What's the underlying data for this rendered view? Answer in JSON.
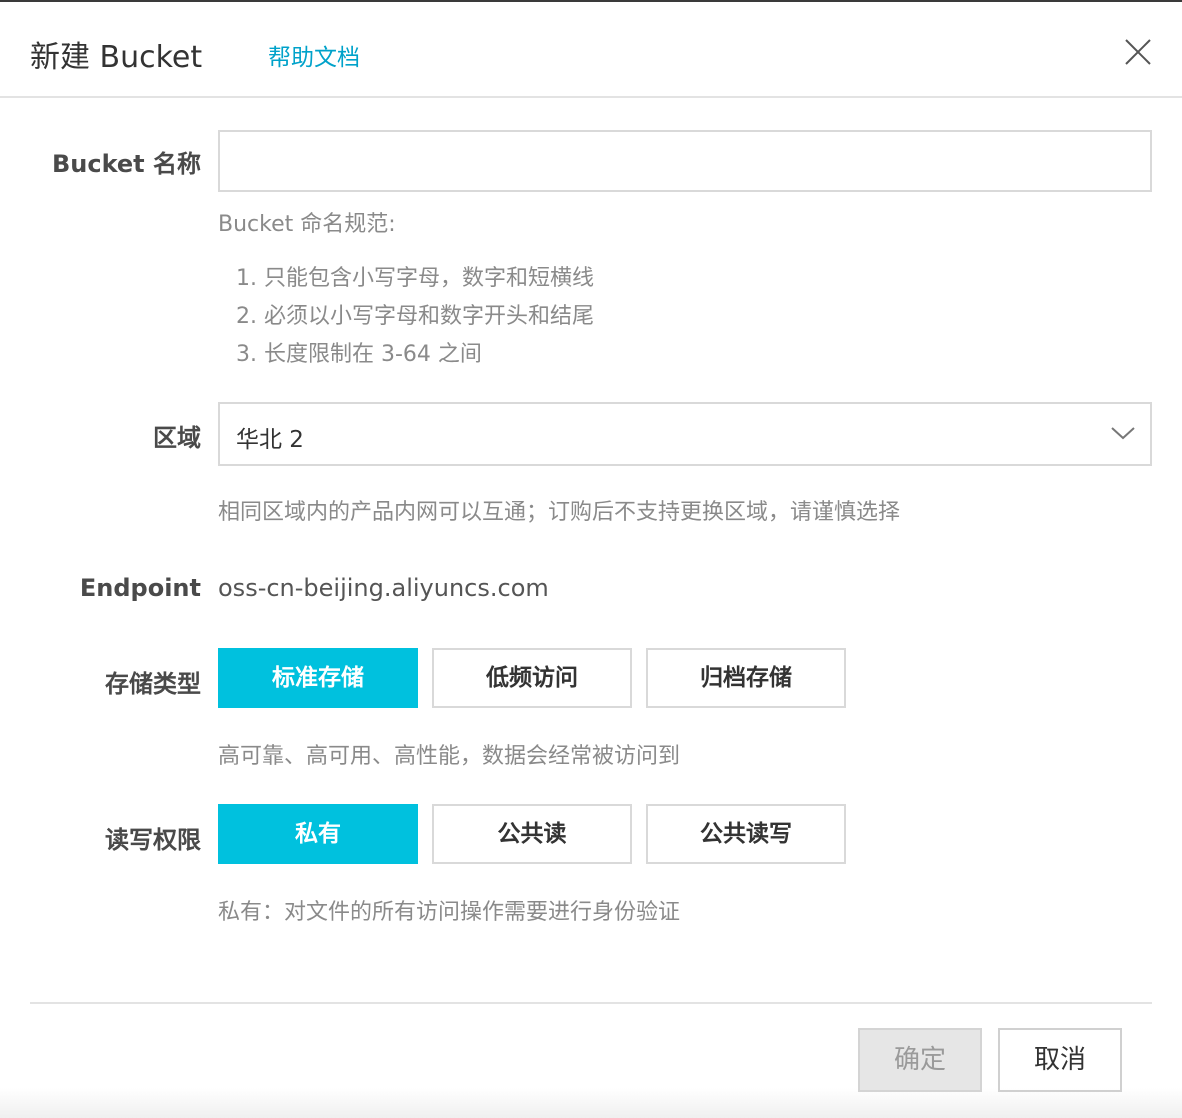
{
  "dialog": {
    "title": "新建 Bucket",
    "help_link": "帮助文档",
    "close_icon": "close-icon"
  },
  "bucket_name": {
    "label": "Bucket 名称",
    "value": "",
    "placeholder": "",
    "rules_title": "Bucket 命名规范:",
    "rules": [
      "1. 只能包含小写字母，数字和短横线",
      "2. 必须以小写字母和数字开头和结尾",
      "3. 长度限制在 3-64 之间"
    ]
  },
  "region": {
    "label": "区域",
    "selected": "华北 2",
    "hint": "相同区域内的产品内网可以互通；订购后不支持更换区域，请谨慎选择",
    "icon": "chevron-down-icon"
  },
  "endpoint": {
    "label": "Endpoint",
    "value": "oss-cn-beijing.aliyuncs.com"
  },
  "storage_type": {
    "label": "存储类型",
    "options": [
      "标准存储",
      "低频访问",
      "归档存储"
    ],
    "selected": "标准存储",
    "hint": "高可靠、高可用、高性能，数据会经常被访问到"
  },
  "acl": {
    "label": "读写权限",
    "options": [
      "私有",
      "公共读",
      "公共读写"
    ],
    "selected": "私有",
    "hint": "私有：对文件的所有访问操作需要进行身份验证"
  },
  "footer": {
    "confirm": "确定",
    "cancel": "取消"
  },
  "colors": {
    "accent": "#00c1de",
    "link": "#00a2ca",
    "disabled_bg": "#e6e6e6"
  }
}
